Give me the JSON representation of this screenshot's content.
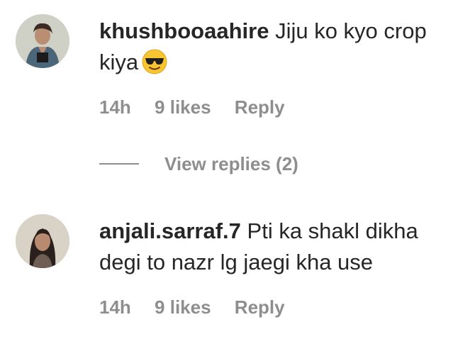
{
  "comments": [
    {
      "username": "khushbooaahire",
      "text": "Jiju ko kyo crop kiya",
      "emoji_icon": "sunglasses-emoji-icon",
      "time": "14h",
      "likes": "9 likes",
      "reply_label": "Reply",
      "view_replies_label": "View replies (2)"
    },
    {
      "username": "anjali.sarraf.7",
      "text": "Pti ka shakl dikha degi to nazr lg jaegi kha use",
      "time": "14h",
      "likes": "9 likes",
      "reply_label": "Reply"
    }
  ],
  "colors": {
    "text_primary": "#262626",
    "text_secondary": "#8e8e8e",
    "background": "#ffffff"
  }
}
